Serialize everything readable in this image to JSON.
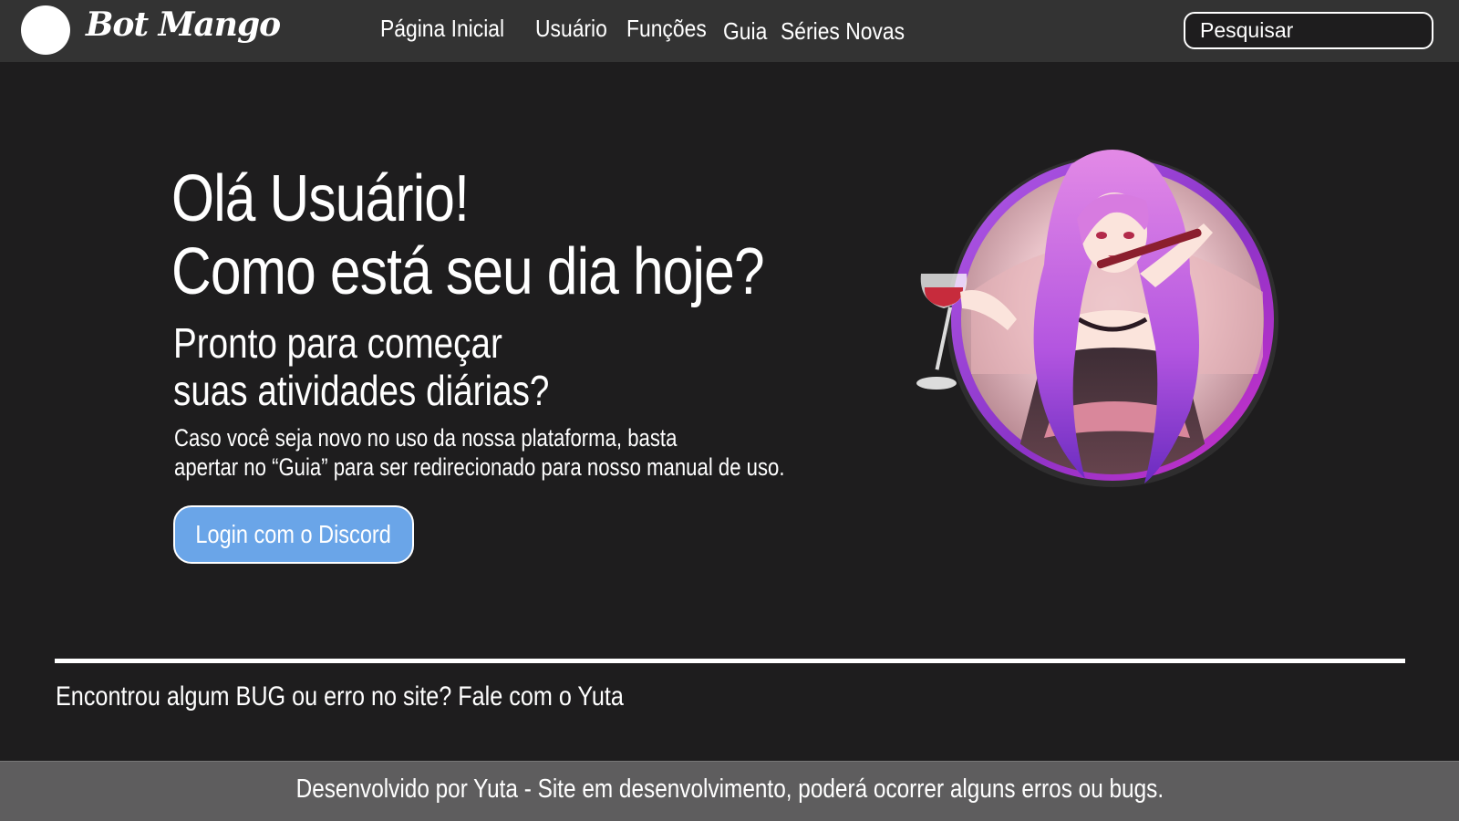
{
  "header": {
    "brand": "Bot Mango",
    "nav": [
      {
        "label": "Página Inicial"
      },
      {
        "label": "Usuário"
      },
      {
        "label": "Funções"
      },
      {
        "label": "Guia"
      },
      {
        "label": "Séries Novas"
      }
    ],
    "search": {
      "placeholder": "Pesquisar",
      "value": ""
    }
  },
  "hero": {
    "title_line1": "Olá Usuário!",
    "title_line2": "Como está seu dia hoje?",
    "subtitle_line1": "Pronto para começar",
    "subtitle_line2": "suas atividades diárias?",
    "desc_line1": "Caso você seja novo no uso da nossa plataforma, basta",
    "desc_line2": "apertar no “Guia” para ser redirecionado para nosso manual de uso.",
    "login_button": "Login com o Discord"
  },
  "bug_report": {
    "prefix": "Encontrou algum BUG ou erro no site? ",
    "link": "Fale com o Yuta"
  },
  "footer": {
    "text": "Desenvolvido por Yuta - Site em desenvolvimento, poderá ocorrer alguns erros ou bugs."
  },
  "colors": {
    "background": "#1e1d1e",
    "topbar": "#333333",
    "footer": "#5e5d5e",
    "button": "#6aa5e8",
    "ring": "#9a3fd6"
  },
  "icons": {
    "avatar": "avatar-circle",
    "illustration": "anime-character-illustration"
  }
}
